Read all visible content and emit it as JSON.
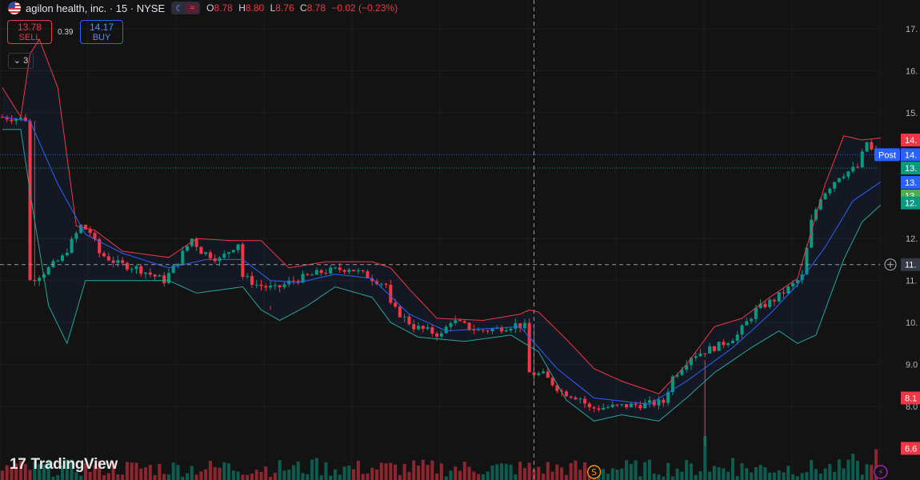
{
  "header": {
    "symbol": "agilon health, inc. · 15 · NYSE",
    "session_icon": "moon-icon",
    "compare_icon": "approx-icon",
    "o_label": "O",
    "o_value": "8.78",
    "h_label": "H",
    "h_value": "8.80",
    "l_label": "L",
    "l_value": "8.76",
    "c_label": "C",
    "c_value": "8.78",
    "change": "−0.02 (−0.23%)"
  },
  "trade": {
    "sell_price": "13.78",
    "sell_label": "SELL",
    "spread": "0.39",
    "buy_price": "14.17",
    "buy_label": "BUY"
  },
  "indicators_toggle": {
    "icon": "chevron-down-icon",
    "count": "3"
  },
  "brand": {
    "logo": "tradingview-logo",
    "name": "TradingView"
  },
  "price_scale": {
    "labels": [
      {
        "text": "17.",
        "value": 17.0
      },
      {
        "text": "16.",
        "value": 16.0
      },
      {
        "text": "15.",
        "value": 15.0
      },
      {
        "text": "12.",
        "value": 12.0
      },
      {
        "text": "11.",
        "value": 11.0
      },
      {
        "text": "10.",
        "value": 10.0
      },
      {
        "text": "9.0",
        "value": 9.0
      },
      {
        "text": "8.0",
        "value": 8.0
      }
    ],
    "badges": [
      {
        "text": "14.",
        "value": 14.35,
        "color": "#f23645"
      },
      {
        "text": "14.",
        "value": 14.0,
        "color": "#2962ff",
        "tag": "Post"
      },
      {
        "text": "13.",
        "value": 13.68,
        "color": "#089981"
      },
      {
        "text": "13.",
        "value": 13.34,
        "color": "#2962ff"
      },
      {
        "text": "13.",
        "value": 13.02,
        "color": "#4caf50"
      },
      {
        "text": "12.",
        "value": 12.85,
        "color": "#089981"
      },
      {
        "text": "8.1",
        "value": 8.2,
        "color": "#f23645"
      },
      {
        "text": "6.6",
        "value": 7.0,
        "color": "#f23645"
      }
    ],
    "crosshair_label": "11."
  },
  "crosshair": {
    "price": 11.38,
    "bar": 115
  },
  "events": [
    {
      "label": "S",
      "bar": 128,
      "color": "#f7931a"
    },
    {
      "label": "⚡",
      "bar": 190,
      "color": "#9c27b0"
    }
  ],
  "colors": {
    "up": "#089981",
    "down": "#f23645",
    "basis": "#2962ff",
    "upper": "#f23645",
    "lower": "#26a69a",
    "background": "#131313"
  },
  "chart_data": {
    "type": "candlestick",
    "title": "agilon health, inc. · 15 · NYSE",
    "ylim": [
      6.75,
      17.55
    ],
    "grid": true,
    "series": [
      {
        "name": "price",
        "close_path": [
          [
            0,
            14.9
          ],
          [
            6,
            14.85
          ],
          [
            7,
            11.0
          ],
          [
            10,
            11.2
          ],
          [
            14,
            11.55
          ],
          [
            18,
            12.3
          ],
          [
            20,
            12.15
          ],
          [
            22,
            11.65
          ],
          [
            26,
            11.4
          ],
          [
            30,
            11.3
          ],
          [
            36,
            11.0
          ],
          [
            38,
            11.3
          ],
          [
            42,
            12.0
          ],
          [
            44,
            11.7
          ],
          [
            48,
            11.5
          ],
          [
            52,
            11.9
          ],
          [
            53,
            11.1
          ],
          [
            56,
            10.9
          ],
          [
            60,
            10.8
          ],
          [
            64,
            11.0
          ],
          [
            70,
            11.2
          ],
          [
            76,
            11.3
          ],
          [
            80,
            11.1
          ],
          [
            84,
            10.9
          ],
          [
            85,
            10.4
          ],
          [
            90,
            9.9
          ],
          [
            96,
            9.7
          ],
          [
            98,
            10.05
          ],
          [
            104,
            9.8
          ],
          [
            108,
            9.85
          ],
          [
            112,
            9.95
          ],
          [
            114,
            9.9
          ],
          [
            115,
            8.8
          ],
          [
            118,
            8.75
          ],
          [
            122,
            8.35
          ],
          [
            126,
            8.2
          ],
          [
            128,
            7.95
          ],
          [
            134,
            8.0
          ],
          [
            140,
            8.05
          ],
          [
            144,
            8.1
          ],
          [
            146,
            8.7
          ],
          [
            150,
            9.2
          ],
          [
            156,
            9.45
          ],
          [
            160,
            9.7
          ],
          [
            164,
            10.3
          ],
          [
            168,
            10.55
          ],
          [
            172,
            10.9
          ],
          [
            174,
            11.1
          ],
          [
            176,
            12.4
          ],
          [
            178,
            13.0
          ],
          [
            182,
            13.5
          ],
          [
            186,
            13.7
          ],
          [
            188,
            14.3
          ],
          [
            190,
            13.9
          ]
        ]
      },
      {
        "name": "basis",
        "path": [
          [
            0,
            14.9
          ],
          [
            6,
            14.8
          ],
          [
            12,
            13.3
          ],
          [
            18,
            12.1
          ],
          [
            26,
            11.65
          ],
          [
            36,
            11.3
          ],
          [
            44,
            11.5
          ],
          [
            52,
            11.5
          ],
          [
            58,
            11.0
          ],
          [
            64,
            10.95
          ],
          [
            72,
            11.15
          ],
          [
            80,
            11.05
          ],
          [
            88,
            10.2
          ],
          [
            96,
            9.8
          ],
          [
            104,
            9.85
          ],
          [
            112,
            9.9
          ],
          [
            120,
            8.9
          ],
          [
            128,
            8.2
          ],
          [
            140,
            8.05
          ],
          [
            148,
            8.6
          ],
          [
            158,
            9.4
          ],
          [
            166,
            10.2
          ],
          [
            172,
            10.9
          ],
          [
            178,
            11.8
          ],
          [
            184,
            12.9
          ],
          [
            190,
            13.35
          ]
        ]
      },
      {
        "name": "upper",
        "path": [
          [
            0,
            15.6
          ],
          [
            4,
            14.9
          ],
          [
            6,
            16.4
          ],
          [
            8,
            16.75
          ],
          [
            12,
            15.6
          ],
          [
            16,
            12.3
          ],
          [
            20,
            12.2
          ],
          [
            26,
            11.7
          ],
          [
            36,
            11.55
          ],
          [
            42,
            12.0
          ],
          [
            50,
            11.95
          ],
          [
            56,
            11.95
          ],
          [
            62,
            11.3
          ],
          [
            70,
            11.45
          ],
          [
            80,
            11.45
          ],
          [
            84,
            11.3
          ],
          [
            88,
            10.8
          ],
          [
            94,
            10.1
          ],
          [
            104,
            10.05
          ],
          [
            112,
            10.2
          ],
          [
            114,
            10.3
          ],
          [
            116,
            10.25
          ],
          [
            122,
            9.6
          ],
          [
            128,
            8.9
          ],
          [
            134,
            8.6
          ],
          [
            142,
            8.3
          ],
          [
            148,
            9.0
          ],
          [
            154,
            9.9
          ],
          [
            160,
            10.1
          ],
          [
            166,
            10.6
          ],
          [
            172,
            11.05
          ],
          [
            178,
            13.3
          ],
          [
            182,
            14.45
          ],
          [
            186,
            14.35
          ],
          [
            190,
            14.4
          ]
        ]
      },
      {
        "name": "lower",
        "path": [
          [
            0,
            14.6
          ],
          [
            4,
            14.6
          ],
          [
            6,
            13.1
          ],
          [
            10,
            10.4
          ],
          [
            14,
            9.5
          ],
          [
            18,
            11.0
          ],
          [
            26,
            11.0
          ],
          [
            36,
            11.0
          ],
          [
            42,
            10.7
          ],
          [
            52,
            10.85
          ],
          [
            56,
            10.3
          ],
          [
            60,
            10.05
          ],
          [
            66,
            10.4
          ],
          [
            72,
            10.85
          ],
          [
            80,
            10.6
          ],
          [
            84,
            10.0
          ],
          [
            90,
            9.65
          ],
          [
            100,
            9.55
          ],
          [
            110,
            9.7
          ],
          [
            116,
            9.3
          ],
          [
            122,
            8.15
          ],
          [
            128,
            7.65
          ],
          [
            134,
            7.8
          ],
          [
            142,
            7.65
          ],
          [
            148,
            8.2
          ],
          [
            154,
            8.8
          ],
          [
            162,
            9.4
          ],
          [
            168,
            9.8
          ],
          [
            172,
            9.5
          ],
          [
            176,
            9.7
          ],
          [
            182,
            11.5
          ],
          [
            186,
            12.4
          ],
          [
            190,
            12.8
          ]
        ]
      }
    ],
    "spikes": [
      [
        7,
        11.0,
        14.8
      ],
      [
        58,
        10.3,
        10.4
      ],
      [
        115,
        8.5,
        9.95
      ],
      [
        152,
        7.05,
        9.1
      ]
    ],
    "volume_spikes": [
      [
        48,
        0.4
      ],
      [
        68,
        0.5
      ],
      [
        152,
        1.0
      ],
      [
        158,
        0.5
      ],
      [
        184,
        0.6
      ],
      [
        189,
        0.7
      ]
    ]
  }
}
